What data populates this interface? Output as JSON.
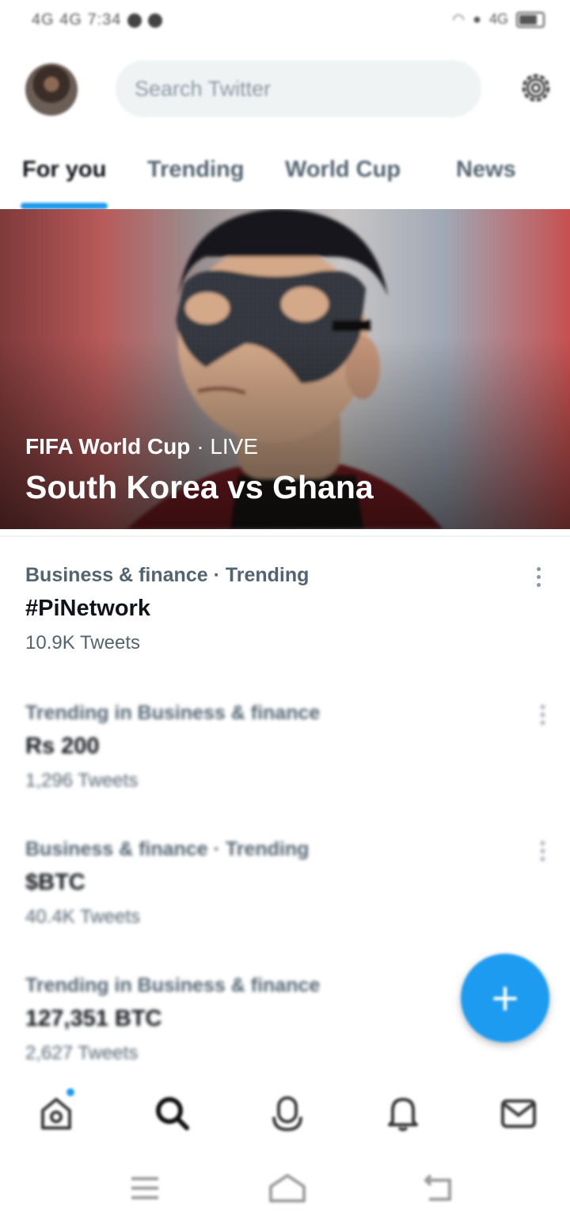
{
  "status_bar": {
    "left_text": "4G 4G 7:34",
    "right_text": "4G"
  },
  "header": {
    "search_placeholder": "Search Twitter"
  },
  "tabs": [
    {
      "label": "For you",
      "active": true
    },
    {
      "label": "Trending",
      "active": false
    },
    {
      "label": "World Cup",
      "active": false
    },
    {
      "label": "News",
      "active": false
    }
  ],
  "hero": {
    "category": "FIFA World Cup",
    "separator": " · ",
    "status": "LIVE",
    "title": "South Korea vs Ghana"
  },
  "trends": [
    {
      "context": "Business & finance · Trending",
      "name": "#PiNetwork",
      "count": "10.9K Tweets"
    },
    {
      "context": "Trending in Business & finance",
      "name": "Rs 200",
      "count": "1,296 Tweets"
    },
    {
      "context": "Business & finance · Trending",
      "name": "$BTC",
      "count": "40.4K Tweets"
    },
    {
      "context": "Trending in Business & finance",
      "name": "127,351 BTC",
      "count": "2,627 Tweets"
    }
  ],
  "fab": {
    "label": "+"
  },
  "bottom_nav": [
    {
      "icon": "home-icon",
      "has_notification": true
    },
    {
      "icon": "search-icon"
    },
    {
      "icon": "spaces-icon"
    },
    {
      "icon": "bell-icon"
    },
    {
      "icon": "mail-icon"
    }
  ],
  "colors": {
    "accent": "#1d9bf0",
    "text_primary": "#0f1419",
    "text_secondary": "#536471",
    "search_bg": "#eff3f4"
  }
}
